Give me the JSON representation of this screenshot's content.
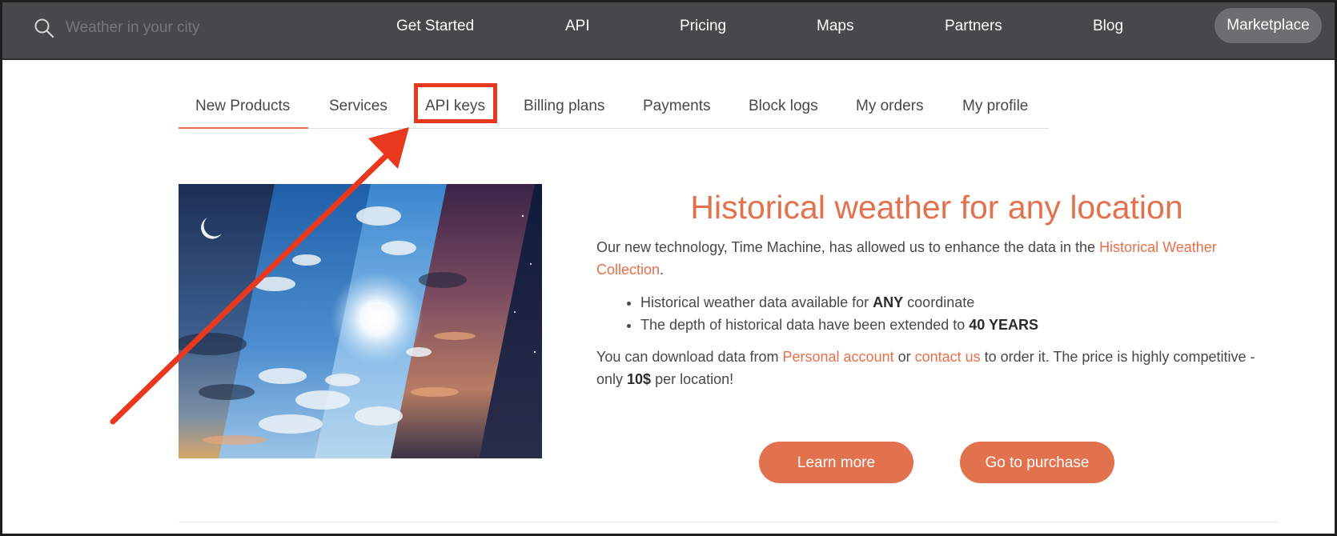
{
  "search": {
    "placeholder": "Weather in your city",
    "value": ""
  },
  "nav": {
    "links": [
      "Get Started",
      "API",
      "Pricing",
      "Maps",
      "Partners",
      "Blog"
    ],
    "marketplace": "Marketplace"
  },
  "tabs": [
    "New Products",
    "Services",
    "API keys",
    "Billing plans",
    "Payments",
    "Block logs",
    "My orders",
    "My profile"
  ],
  "active_tab": "New Products",
  "highlighted_tab": "API keys",
  "content": {
    "headline": "Historical weather for any location",
    "intro_text": "Our new technology, Time Machine, has allowed us to enhance the data in the ",
    "intro_link": "Historical Weather Collection",
    "intro_end": ".",
    "bullet1_pre": "Historical weather data available for ",
    "bullet1_bold": "ANY",
    "bullet1_post": " coordinate",
    "bullet2_pre": "The depth of historical data have been extended to ",
    "bullet2_bold": "40 YEARS",
    "outro_pre": "You can download data from ",
    "outro_link1": "Personal account",
    "outro_mid": " or ",
    "outro_link2": "contact us",
    "outro_post": " to order it. The price is highly competitive - only ",
    "outro_bold": "10$",
    "outro_end": " per location!"
  },
  "buttons": {
    "learn_more": "Learn more",
    "purchase": "Go to purchase"
  },
  "colors": {
    "accent": "#e2714d",
    "link": "#eb6e4b",
    "annotation": "#e8391e",
    "topbar": "#48484a",
    "marketplace_pill": "#6e6e70"
  },
  "icons": {
    "search": "search-icon"
  }
}
